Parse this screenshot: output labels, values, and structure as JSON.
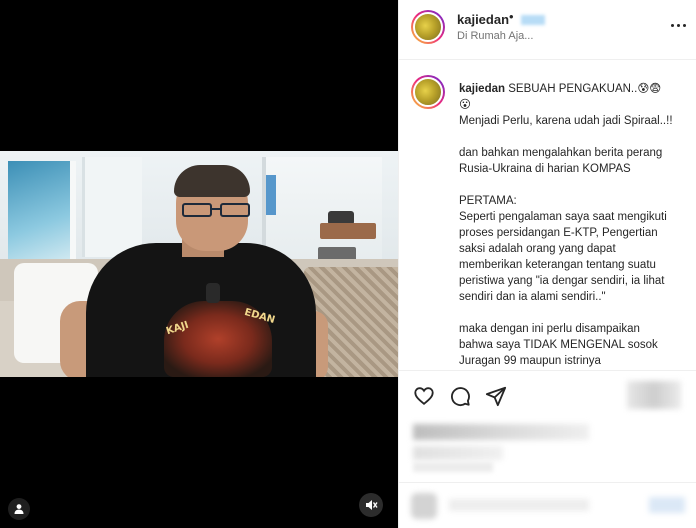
{
  "post": {
    "username": "kajiedan",
    "separator": "•",
    "location": "Di Rumah Aja..."
  },
  "caption": {
    "username": "kajiedan",
    "lines": [
      " SEBUAH PENGAKUAN..😰😨",
      "😮",
      "Menjadi Perlu, karena udah jadi Spiraal..!!",
      "",
      "dan bahkan mengalahkan berita perang",
      "Rusia-Ukraina di harian KOMPAS",
      "",
      "PERTAMA:",
      "Seperti pengalaman saya saat mengikuti",
      "proses persidangan E-KTP, Pengertian",
      "saksi adalah orang yang dapat",
      "memberikan keterangan tentang suatu",
      "peristiwa yang \"ia dengar sendiri, ia lihat",
      "sendiri dan ia alami sendiri..\"",
      "",
      "maka dengan ini perlu disampaikan",
      "bahwa saya TIDAK MENGENAL sosok",
      "Juragan 99 maupun istrinya"
    ]
  },
  "video": {
    "shirt_text_left": "KAJI",
    "shirt_text_right": "EDAN"
  },
  "icons": {
    "like": "heart-icon",
    "comment": "comment-icon",
    "share": "share-icon",
    "more": "more-options-icon",
    "tag": "user-tag-icon",
    "mute": "muted-audio-icon"
  },
  "colors": {
    "avatar_ring_start": "#f9ce34",
    "avatar_ring_mid": "#ee2a7b",
    "avatar_ring_end": "#6228d7",
    "text": "#262626",
    "secondary_text": "#737373"
  }
}
